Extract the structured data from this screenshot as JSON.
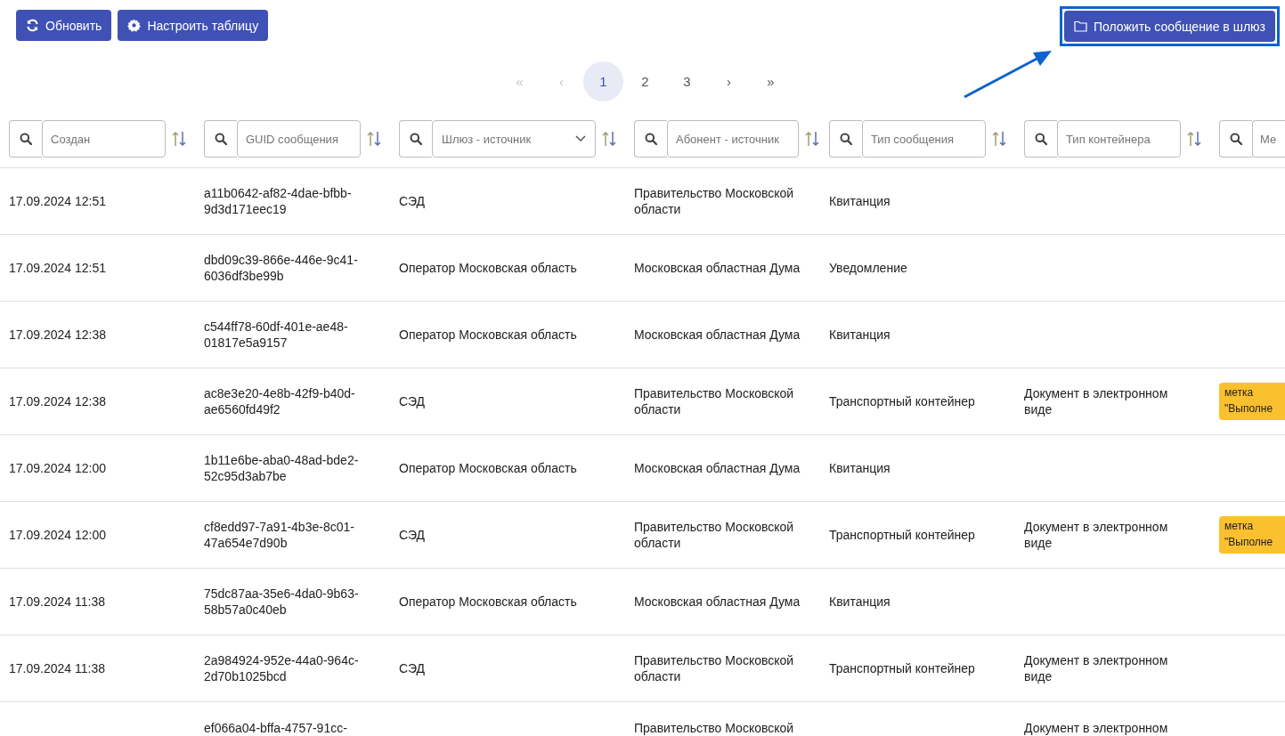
{
  "toolbar": {
    "buttons": [
      {
        "label": "Обновить",
        "kind": "refresh"
      },
      {
        "label": "Настроить таблицу",
        "kind": "settings"
      }
    ],
    "action_button": {
      "label": "Положить сообщение в шлюз",
      "highlighted": true
    }
  },
  "pagination": [
    {
      "label": "«",
      "disabled": true,
      "selected": false
    },
    {
      "label": "‹",
      "disabled": true,
      "selected": false
    },
    {
      "label": "1",
      "disabled": false,
      "selected": true
    },
    {
      "label": "2",
      "disabled": false,
      "selected": false
    },
    {
      "label": "3",
      "disabled": false,
      "selected": false
    },
    {
      "label": "›",
      "disabled": false,
      "selected": false
    },
    {
      "label": "»",
      "disabled": false,
      "selected": false
    }
  ],
  "columns": [
    {
      "kind": "search",
      "placeholder": "Создан",
      "sort_icon": true
    },
    {
      "kind": "search",
      "placeholder": "GUID сообщения",
      "sort_icon": true
    },
    {
      "kind": "select",
      "placeholder": "Шлюз - источник",
      "sort_icon": true
    },
    {
      "kind": "search",
      "placeholder": "Абонент - источник",
      "sort_icon": true
    },
    {
      "kind": "search",
      "placeholder": "Тип сообщения",
      "sort_icon": true
    },
    {
      "kind": "search",
      "placeholder": "Тип контейнера",
      "sort_icon": true
    },
    {
      "kind": "search",
      "placeholder": "Ме",
      "sort_icon": false
    }
  ],
  "rows": [
    {
      "created": "17.09.2024 12:51",
      "guid": "a11b0642-af82-4dae-bfbb-9d3d171eec19",
      "gateway": "СЭД",
      "subscriber": "Правительство Московской области",
      "message_type": "Квитанция"
    },
    {
      "created": "17.09.2024 12:51",
      "guid": "dbd09c39-866e-446e-9c41-6036df3be99b",
      "gateway": "Оператор Московская область",
      "subscriber": "Московская областная Дума",
      "message_type": "Уведомление"
    },
    {
      "created": "17.09.2024 12:38",
      "guid": "c544ff78-60df-401e-ae48-01817e5a9157",
      "gateway": "Оператор Московская область",
      "subscriber": "Московская областная Дума",
      "message_type": "Квитанция"
    },
    {
      "created": "17.09.2024 12:38",
      "guid": "ac8e3e20-4e8b-42f9-b40d-ae6560fd49f2",
      "gateway": "СЭД",
      "subscriber": "Правительство Московской области",
      "message_type": "Транспортный контейнер",
      "container_type": "Документ в электронном виде",
      "tag": "метка \"Выполне"
    },
    {
      "created": "17.09.2024 12:00",
      "guid": "1b11e6be-aba0-48ad-bde2-52c95d3ab7be",
      "gateway": "Оператор Московская область",
      "subscriber": "Московская областная Дума",
      "message_type": "Квитанция"
    },
    {
      "created": "17.09.2024 12:00",
      "guid": "cf8edd97-7a91-4b3e-8c01-47a654e7d90b",
      "gateway": "СЭД",
      "subscriber": "Правительство Московской области",
      "message_type": "Транспортный контейнер",
      "container_type": "Документ в электронном виде",
      "tag": "метка \"Выполне"
    },
    {
      "created": "17.09.2024 11:38",
      "guid": "75dc87aa-35e6-4da0-9b63-58b57a0c40eb",
      "gateway": "Оператор Московская область",
      "subscriber": "Московская областная Дума",
      "message_type": "Квитанция"
    },
    {
      "created": "17.09.2024 11:38",
      "guid": "2a984924-952e-44a0-964c-2d70b1025bcd",
      "gateway": "СЭД",
      "subscriber": "Правительство Московской области",
      "message_type": "Транспортный контейнер",
      "container_type": "Документ в электронном виде"
    },
    {
      "guid": "ef066a04-bffa-4757-91cc-",
      "subscriber": "Правительство Московской",
      "container_type": "Документ в электронном"
    }
  ]
}
